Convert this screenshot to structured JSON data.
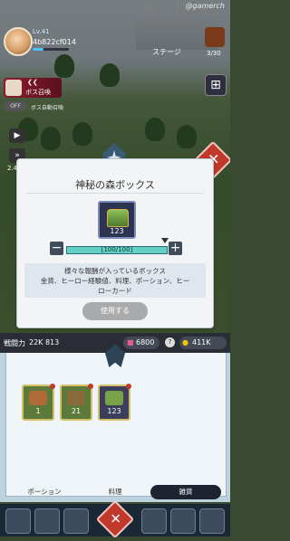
{
  "watermark": "@gamerch",
  "player": {
    "level": "Lv.41",
    "name": "4b822cf014"
  },
  "boss": {
    "label": "ボス召喚"
  },
  "auto": {
    "toggle": "OFF",
    "label": "ボス自動召喚"
  },
  "stage": {
    "label": "ステージ",
    "count": "3/30"
  },
  "side": {
    "value": "2.4"
  },
  "modal": {
    "title": "神秘の森ボックス",
    "item_count": "123",
    "slider_value": "[100/100]",
    "minus": "−",
    "plus": "+",
    "desc_line1": "様々な報酬が入っているボックス",
    "desc_line2": "金貨、ヒーロー経験値、料理、ポーション、ヒー",
    "desc_line3": "ローカード",
    "use_label": "使用する"
  },
  "status": {
    "power_label": "戦闘力",
    "power_value": "22K 813",
    "gem": "6800",
    "help": "?",
    "gold": "411K"
  },
  "inventory": {
    "items": [
      {
        "count": "1"
      },
      {
        "count": "21"
      },
      {
        "count": "123"
      }
    ],
    "tabs": [
      "ポーション",
      "料理",
      "雑貨"
    ]
  },
  "colors": {
    "accent": "#c0392b",
    "slider": "#62d0c4",
    "tab_active": "#1e2330"
  }
}
